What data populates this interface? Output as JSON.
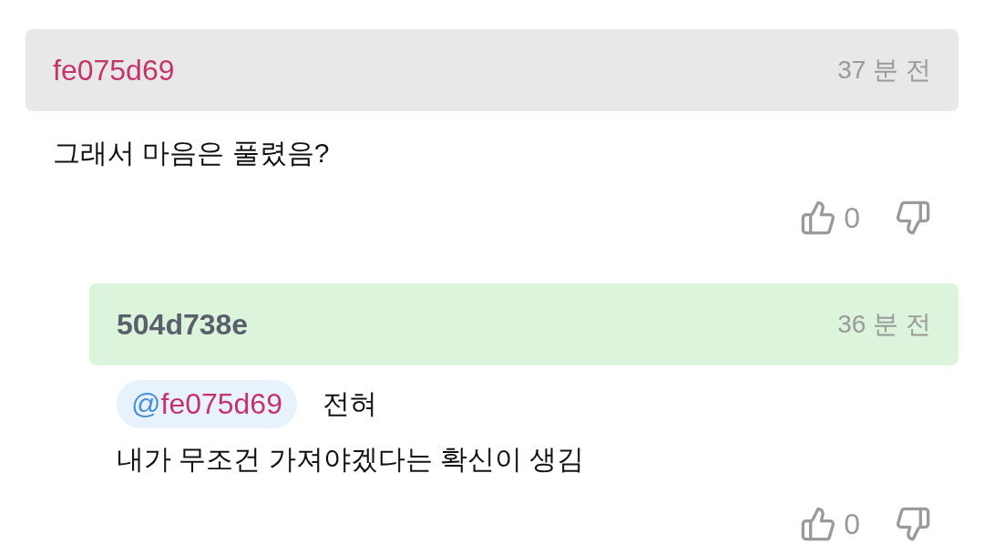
{
  "comments": [
    {
      "kind": "comment",
      "author": "fe075d69",
      "time": "37 분 전",
      "lines": [
        "그래서 마음은 풀렸음?"
      ],
      "likes": "0"
    },
    {
      "kind": "reply",
      "author": "504d738e",
      "time": "36 분 전",
      "mention": {
        "at": "@",
        "user": "fe075d69"
      },
      "lines": [
        "전혀",
        "내가 무조건 가져야겠다는 확신이 생김"
      ],
      "likes": "0"
    }
  ]
}
